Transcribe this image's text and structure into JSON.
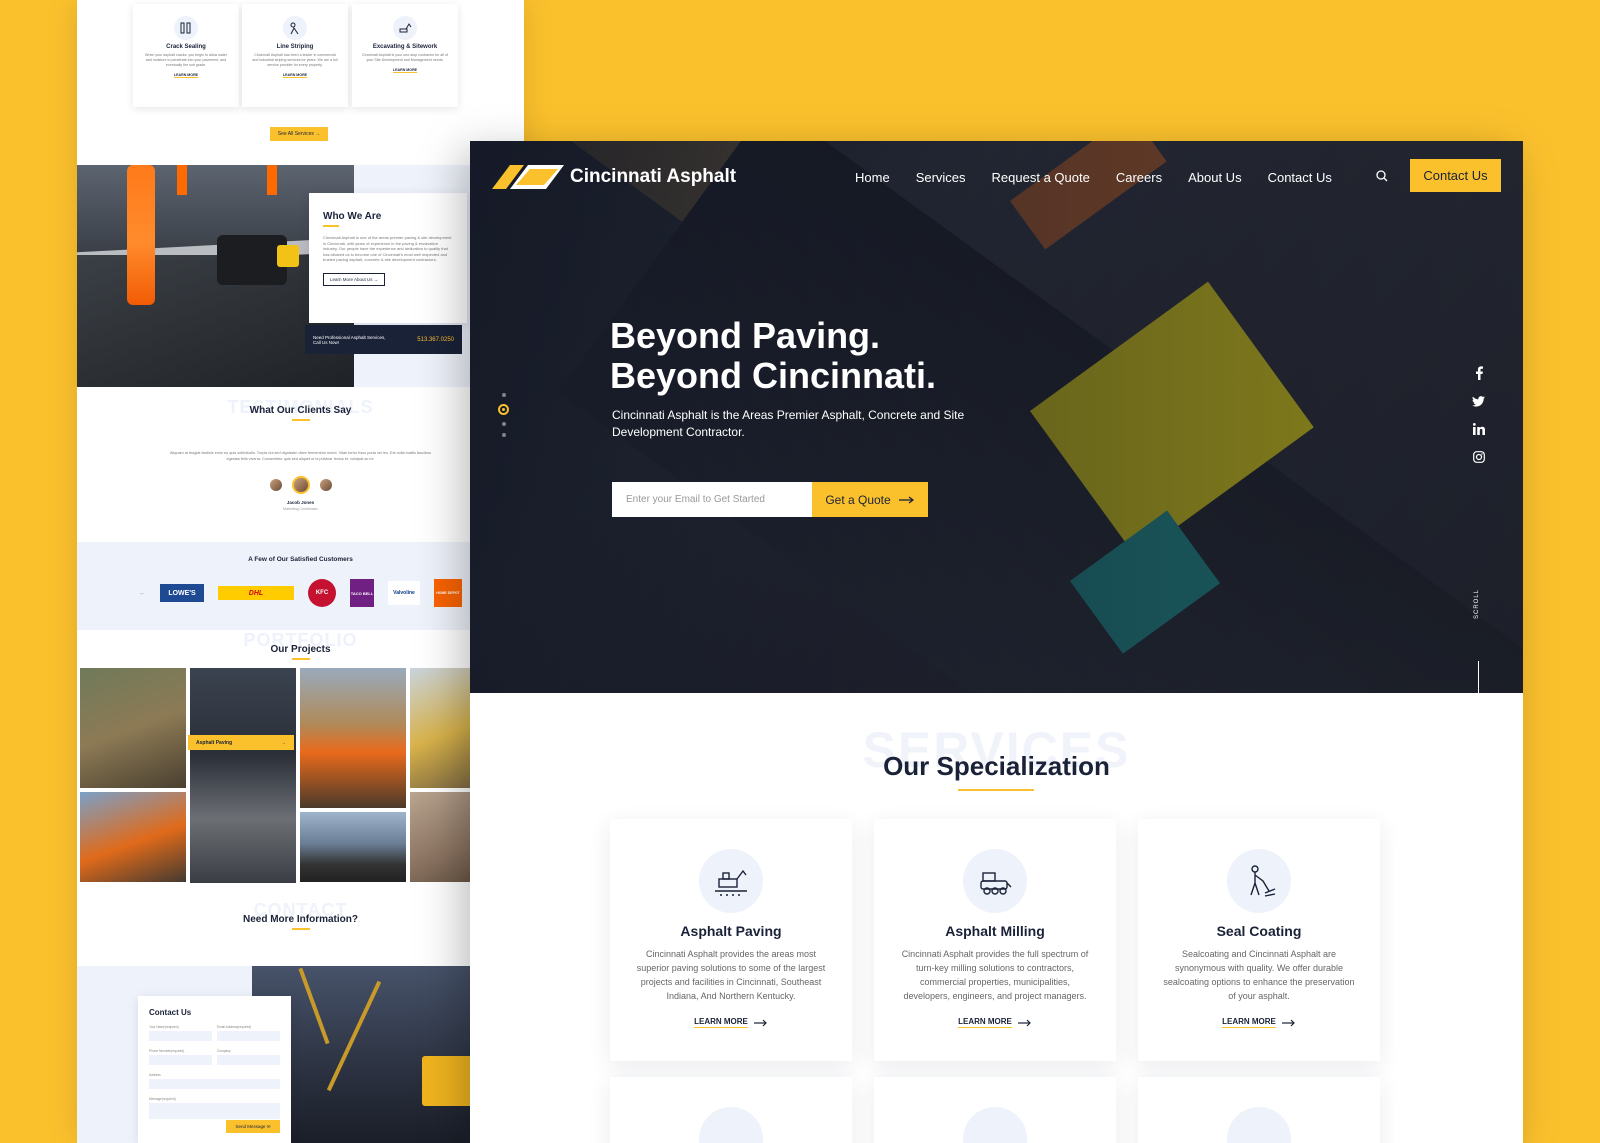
{
  "back": {
    "services": [
      {
        "title": "Crack Sealing",
        "desc": "When your asphalt cracks, you begin to allow water and moisture to penetrate into your pavement, and eventually the sub grade.",
        "more": "LEARN MORE"
      },
      {
        "title": "Line Striping",
        "desc": "Cincinnati Asphalt has been a leader in commercial and industrial striping services for years. We are a full service provider for every property.",
        "more": "LEARN MORE"
      },
      {
        "title": "Excavating & Sitework",
        "desc": "Cincinnati Asphalt is your one-stop contractor for all of your Site Development and Management needs.",
        "more": "LEARN MORE"
      }
    ],
    "see_all": "See All Services",
    "who": {
      "title": "Who We Are",
      "body": "Cincinnati Asphalt is one of the areas premier paving & site development in Cincinnati, with years of experience in the paving & excavation industry. Our people have the experience and dedication to quality that has allowed us to become one of Cincinnati's most well respected and trusted paving asphalt, concrete & site development contractors.",
      "button": "Learn More About Us",
      "call_text": "Need Professional Asphalt Services, Call Us Now!",
      "phone": "513.367.0250"
    },
    "testimonials": {
      "ghost": "TESTIMONIALS",
      "title": "What Our Clients Say",
      "quote": "Aliquam at feugiat facilisis enim eu quis sollicitudin. Turpis dui sed dignissim diam fermentum morbi. Vitae tortor risus porta vel leo. Est nulla mattis faucibus egestas felis viverra. Consectetur quis sed aliquet ut id pulvinar lectus et, volutpat ac mi.",
      "name": "Jacob Jones",
      "role": "Marketing Coordinator"
    },
    "customers": {
      "title": "A Few of Our Satisfied Customers",
      "logos": [
        "LOWE'S",
        "DHL",
        "KFC",
        "TACO BELL",
        "Valvoline",
        "HOME DEPOT"
      ]
    },
    "projects": {
      "ghost": "PORTFOLIO",
      "title": "Our Projects",
      "label": "Asphalt Paving"
    },
    "contact": {
      "ghost": "CONTACT",
      "title": "Need More Information?",
      "form_title": "Contact Us",
      "fields": [
        "Your Name(required)",
        "Email Address(required)",
        "Phone Number(required)",
        "Company",
        "Address",
        "Message(required)"
      ],
      "send": "Send Message"
    }
  },
  "front": {
    "brand": "Cincinnati Asphalt",
    "nav": [
      "Home",
      "Services",
      "Request a Quote",
      "Careers",
      "About Us",
      "Contact Us"
    ],
    "cta": "Contact Us",
    "hero_line1": "Beyond Paving.",
    "hero_line2": "Beyond Cincinnati.",
    "hero_sub": "Cincinnati Asphalt is the Areas Premier Asphalt, Concrete and Site Development Contractor.",
    "email_placeholder": "Enter your Email to Get Started",
    "quote_button": "Get a Quote",
    "scroll": "SCROLL",
    "services_ghost": "SERVICES",
    "services_title": "Our Specialization",
    "services": [
      {
        "title": "Asphalt Paving",
        "desc": "Cincinnati Asphalt provides the areas most superior paving solutions to some of the largest projects and facilities in Cincinnati, Southeast Indiana, And Northern Kentucky.",
        "more": "LEARN MORE",
        "icon": "paver-icon"
      },
      {
        "title": "Asphalt Milling",
        "desc": "Cincinnati Asphalt provides the full spectrum of turn-key milling solutions to contractors, commercial properties, municipalities, developers, engineers, and project managers.",
        "more": "LEARN MORE",
        "icon": "milling-machine-icon"
      },
      {
        "title": "Seal Coating",
        "desc": "Sealcoating and Cincinnati Asphalt are synonymous with quality. We offer durable sealcoating options to enhance the preservation of your asphalt.",
        "more": "LEARN MORE",
        "icon": "sealcoat-worker-icon"
      }
    ]
  },
  "colors": {
    "accent": "#FBC12D",
    "navy": "#1a2238",
    "light": "#eef2fa"
  }
}
